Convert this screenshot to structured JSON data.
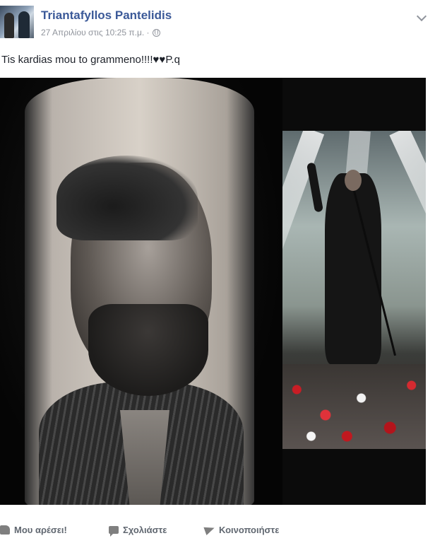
{
  "post": {
    "author": "Triantafyllos Pantelidis",
    "timestamp": "27 Απριλίου στις 10:25 π.μ. ·",
    "privacy_icon": "globe-icon",
    "text": "Tis kardias mou to grammeno!!!!♥♥P.q"
  },
  "actions": {
    "like_label": "Μου αρέσει!",
    "comment_label": "Σχολιάστε",
    "share_label": "Κοινοποιήστε"
  }
}
